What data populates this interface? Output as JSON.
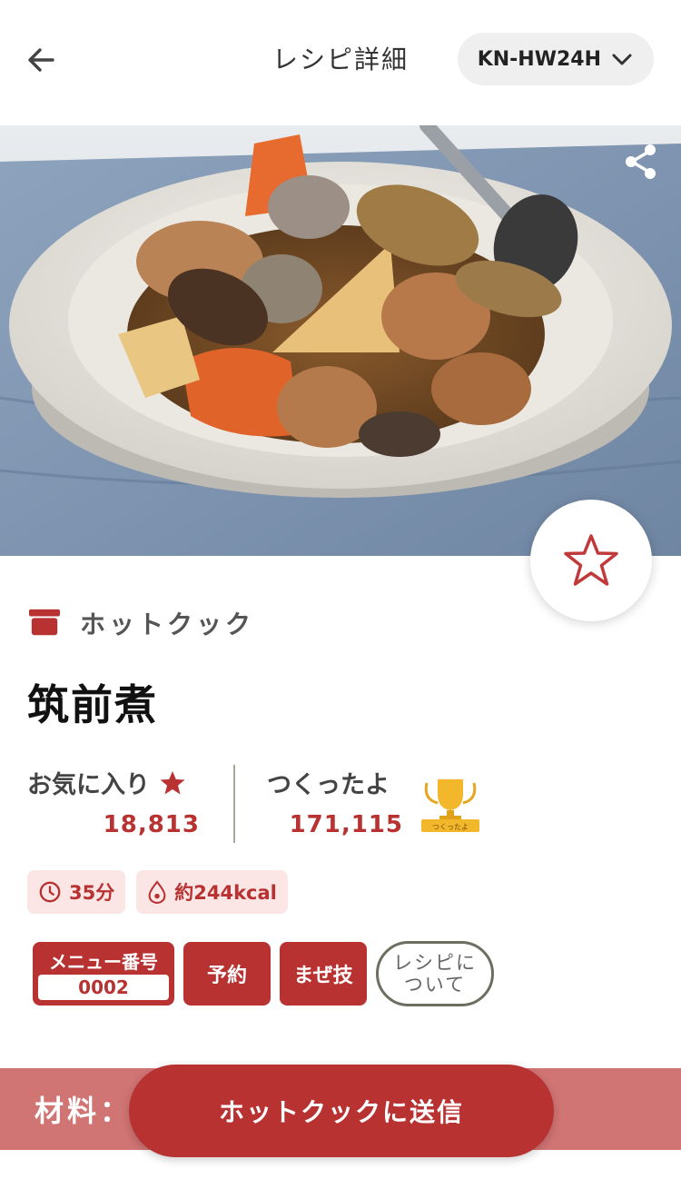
{
  "header": {
    "title": "レシピ詳細",
    "model": "KN-HW24H"
  },
  "hero": {
    "image_alt": "筑前煮"
  },
  "device": {
    "label": "ホットクック"
  },
  "recipe": {
    "name": "筑前煮"
  },
  "stats": {
    "favorites_label": "お気に入り",
    "favorites_count": "18,813",
    "made_label": "つくったよ",
    "made_count": "171,115",
    "trophy_text": "つくったよ"
  },
  "chips": {
    "time": "35分",
    "calories": "約244kcal"
  },
  "tags": {
    "menu_label": "メニュー番号",
    "menu_number": "0002",
    "reserve": "予約",
    "technique": "まぜ技",
    "about_line1": "レシピに",
    "about_line2": "ついて"
  },
  "bottom": {
    "ingredients_label": "材料：",
    "send_button": "ホットクックに送信"
  },
  "colors": {
    "accent": "#b83232",
    "chip_bg": "#fbe5e5",
    "bar": "#d17474"
  }
}
